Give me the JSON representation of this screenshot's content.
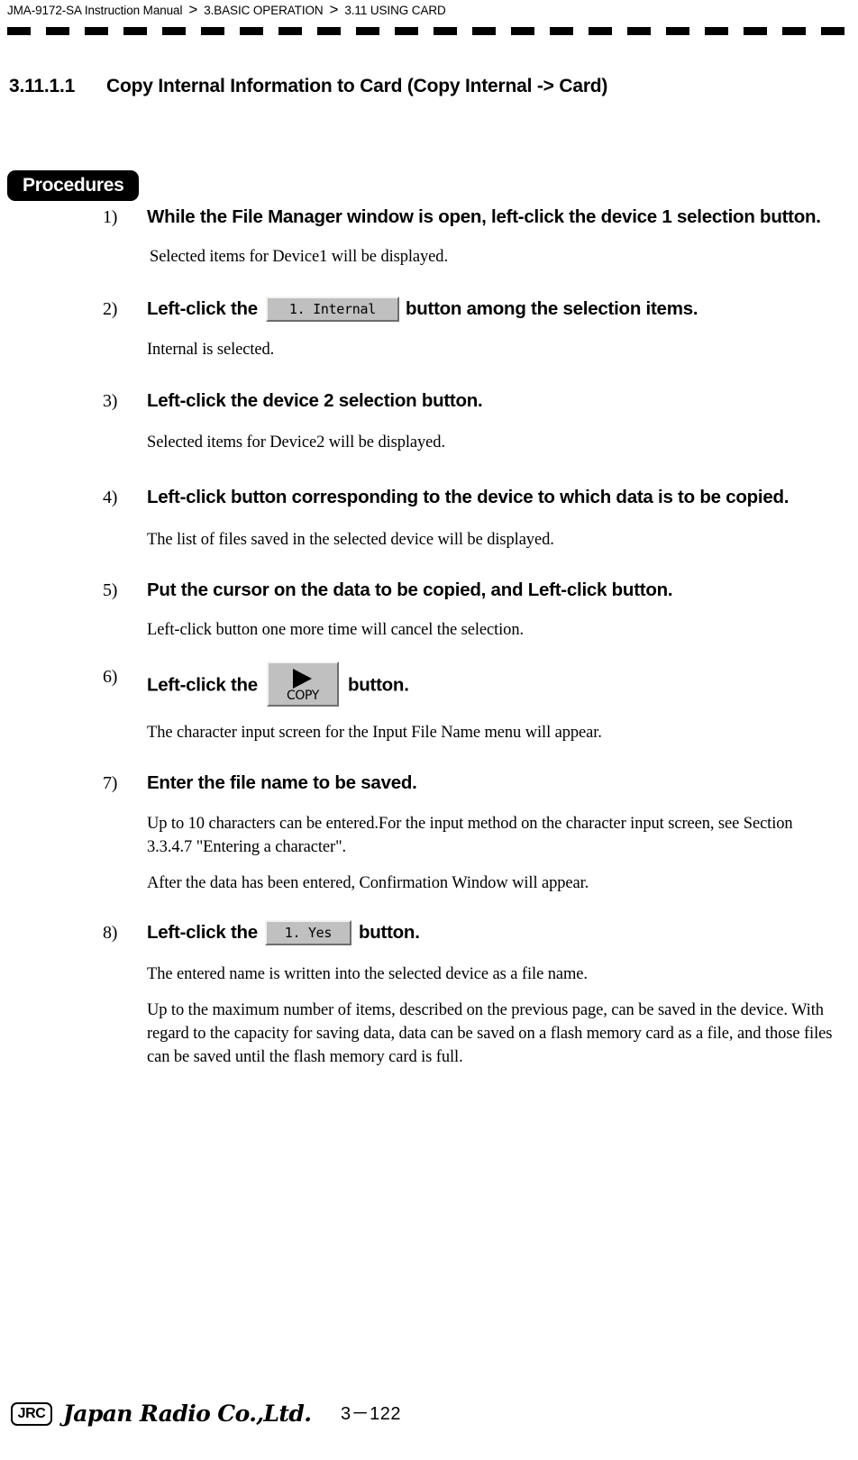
{
  "header": {
    "manual": "JMA-9172-SA Instruction Manual",
    "separator": ">",
    "chapter": "3.BASIC OPERATION",
    "section": "3.11  USING CARD"
  },
  "section": {
    "number": "3.11.1.1",
    "title": "Copy Internal Information to Card (Copy Internal -> Card)"
  },
  "procedures": {
    "badge": "Procedures",
    "steps": [
      {
        "num": "1)",
        "head_before": "While the File Manager window is open, left-click the device 1 selection button.",
        "note": "Selected items for  Device1  will be displayed."
      },
      {
        "num": "2)",
        "head_before": "Left-click the",
        "button": "1. Internal",
        "head_after": "button among the selection items.",
        "note": "Internal  is selected."
      },
      {
        "num": "3)",
        "head_before": "Left-click the device 2 selection button.",
        "note": "Selected items for  Device2  will be displayed."
      },
      {
        "num": "4)",
        "head_before": "Left-click button corresponding to the device to which data is to be copied.",
        "note": "The list of files saved in the selected device will be displayed."
      },
      {
        "num": "5)",
        "head_before": "Put the cursor on the data to be copied, and Left-click button.",
        "note": "Left-click button one more time will cancel the selection."
      },
      {
        "num": "6)",
        "head_before": "Left-click the",
        "button": "COPY",
        "head_after": "button.",
        "note": "The character input screen for the Input File Name menu will appear."
      },
      {
        "num": "7)",
        "head_before": "Enter the file name to be saved.",
        "note": "Up to 10 characters can be entered.For the input method on the character input screen, see Section 3.3.4.7 \"Entering a character\".",
        "note2": "After the data has been entered, Confirmation Window will appear."
      },
      {
        "num": "8)",
        "head_before": "Left-click the",
        "button": "1. Yes",
        "head_after": "button.",
        "note": "The entered name is written into the selected device as a file name.",
        "note2": "Up to the maximum number of items, described on the previous page, can be saved in the device. With regard to the capacity for saving data, data can be saved on a flash memory card as a file, and those files can be saved until the flash memory card is full."
      }
    ]
  },
  "footer": {
    "logo_mark": "JRC",
    "company": "Japan Radio Co.,Ltd.",
    "page": "3－122"
  }
}
